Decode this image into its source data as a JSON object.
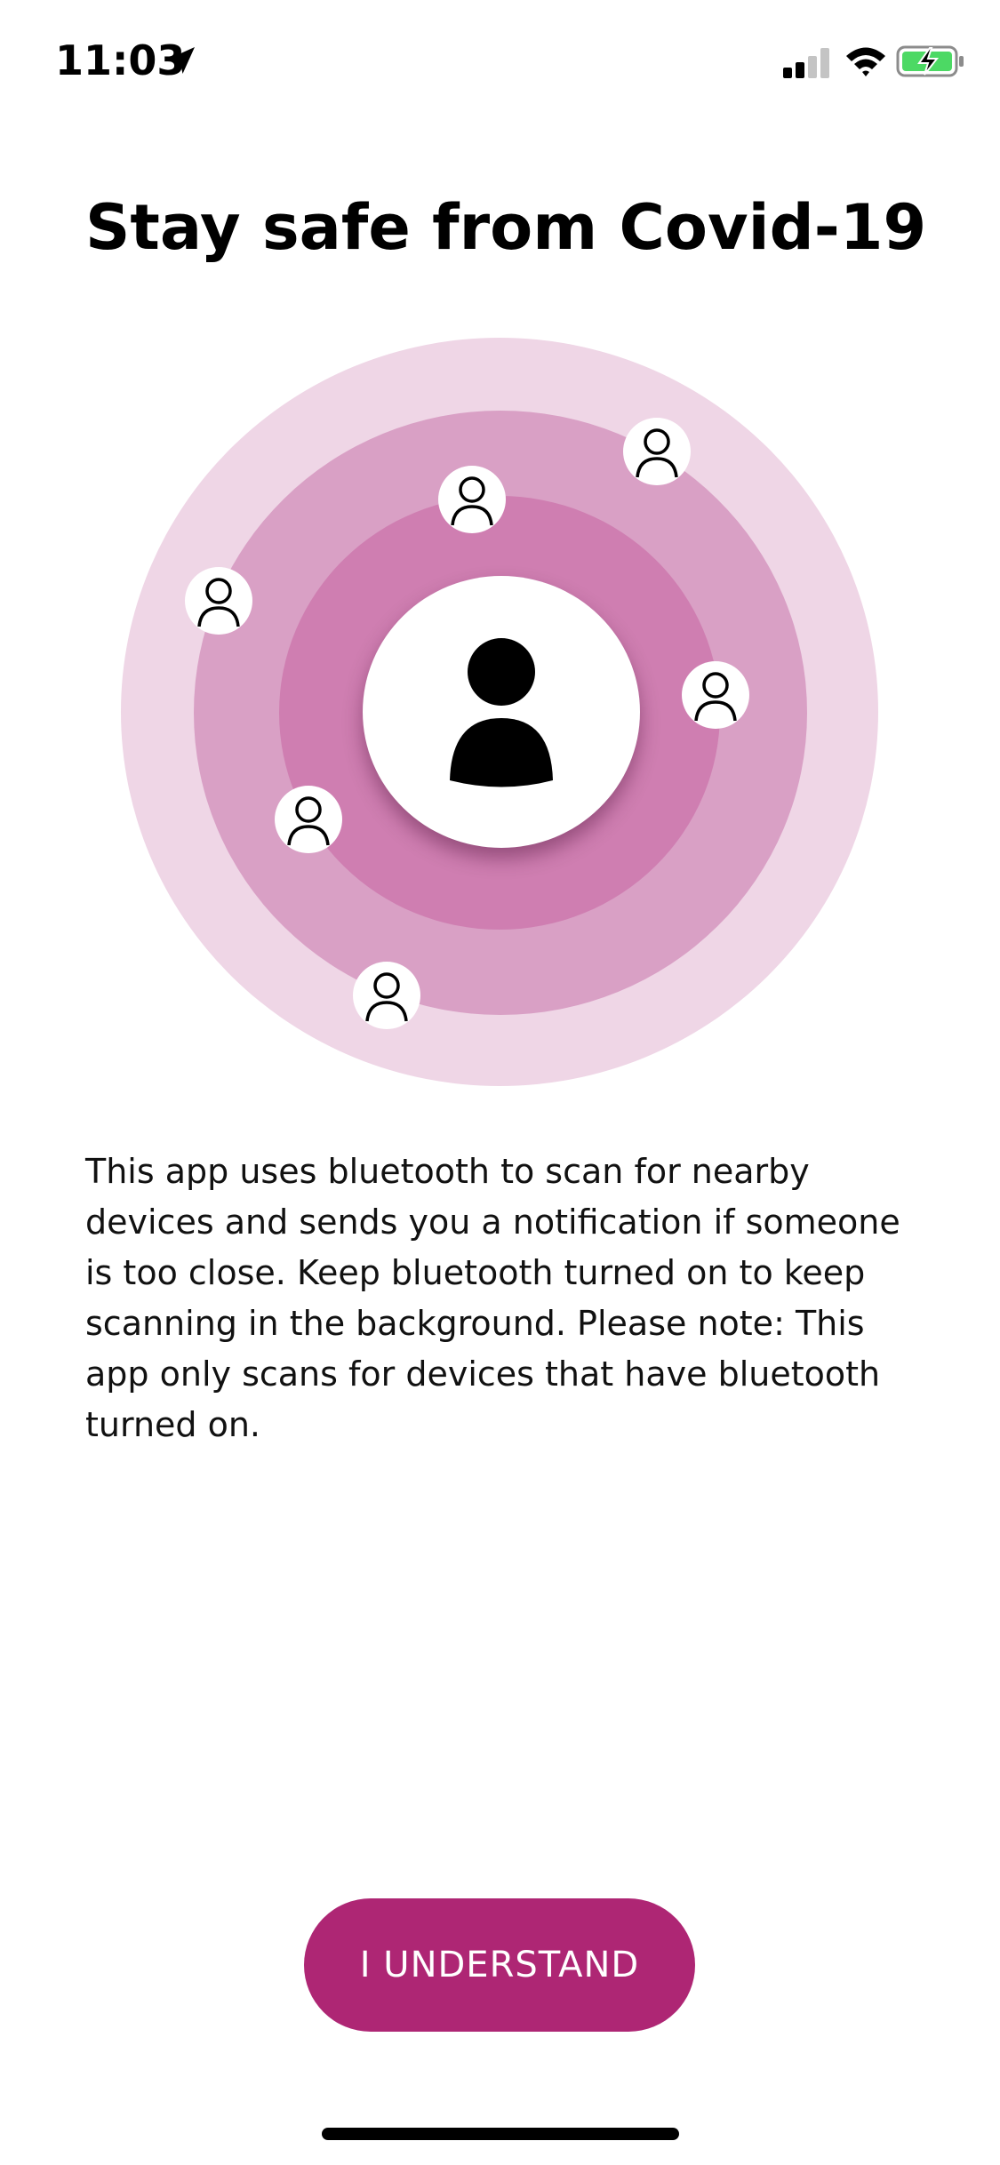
{
  "status_bar": {
    "time": "11:03",
    "icons": [
      "location-arrow-icon",
      "cellular-signal-icon",
      "wifi-icon",
      "battery-charging-icon"
    ],
    "signal_bars_active": 2,
    "signal_bars_total": 4
  },
  "onboarding": {
    "title": "Stay safe from Covid-19",
    "description": "This app uses bluetooth to scan for nearby devices and sends you a notification if someone is too close. Keep bluetooth turned on to keep scanning in the background. Please note: This app only scans for devices that have bluetooth turned on.",
    "primary_button_label": "I UNDERSTAND"
  },
  "illustration": {
    "icons": [
      "user-icon",
      "person-outline-icon"
    ],
    "nearby_people_count": 6
  },
  "colors": {
    "ring_outer": "#efd6e6",
    "ring_middle": "#d9a0c5",
    "ring_inner": "#cf7eb1",
    "accent": "#ae2674",
    "battery_fill": "#4cd964"
  }
}
